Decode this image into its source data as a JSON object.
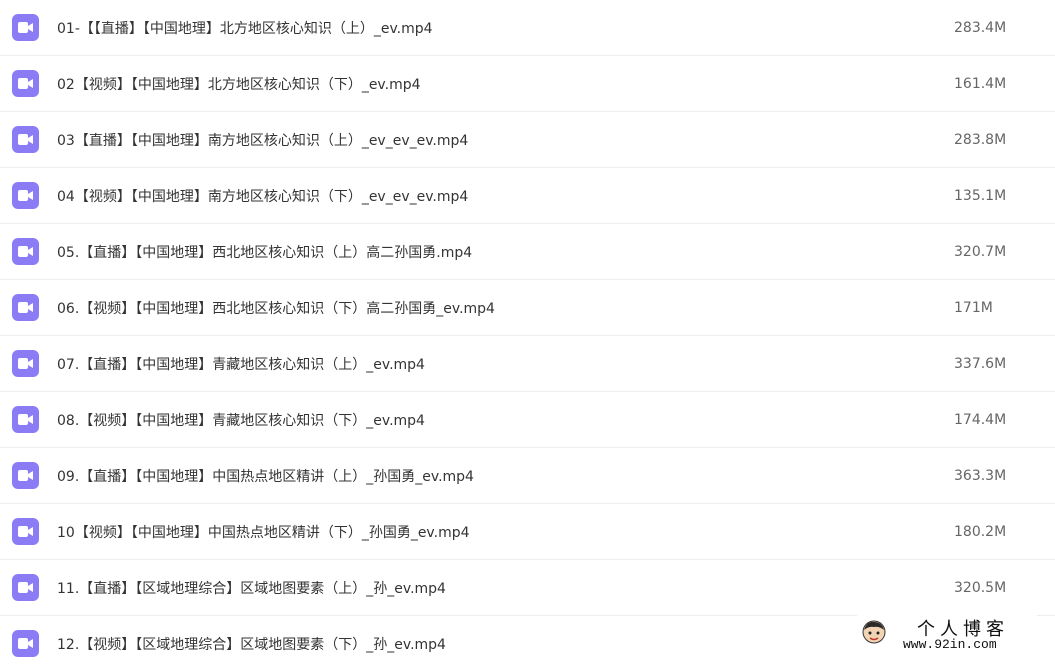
{
  "files": [
    {
      "name": "01-【【直播】【中国地理】北方地区核心知识（上）_ev.mp4",
      "size": "283.4M"
    },
    {
      "name": "02【视频】【中国地理】北方地区核心知识（下）_ev.mp4",
      "size": "161.4M"
    },
    {
      "name": "03【直播】【中国地理】南方地区核心知识（上）_ev_ev_ev.mp4",
      "size": "283.8M"
    },
    {
      "name": "04【视频】【中国地理】南方地区核心知识（下）_ev_ev_ev.mp4",
      "size": "135.1M"
    },
    {
      "name": "05.【直播】【中国地理】西北地区核心知识（上）高二孙国勇.mp4",
      "size": "320.7M"
    },
    {
      "name": "06.【视频】【中国地理】西北地区核心知识（下）高二孙国勇_ev.mp4",
      "size": "171M"
    },
    {
      "name": "07.【直播】【中国地理】青藏地区核心知识（上）_ev.mp4",
      "size": "337.6M"
    },
    {
      "name": "08.【视频】【中国地理】青藏地区核心知识（下）_ev.mp4",
      "size": "174.4M"
    },
    {
      "name": "09.【直播】【中国地理】中国热点地区精讲（上）_孙国勇_ev.mp4",
      "size": "363.3M"
    },
    {
      "name": "10【视频】【中国地理】中国热点地区精讲（下）_孙国勇_ev.mp4",
      "size": "180.2M"
    },
    {
      "name": "11.【直播】【区域地理综合】区域地图要素（上）_孙_ev.mp4",
      "size": "320.5M"
    },
    {
      "name": "12.【视频】【区域地理综合】区域地图要素（下）_孙_ev.mp4",
      "size": ""
    }
  ],
  "icon": {
    "name": "video-file-icon",
    "color": "#8b7cf6"
  },
  "watermark": {
    "title": "个人博客",
    "url": "www.92in.com"
  }
}
